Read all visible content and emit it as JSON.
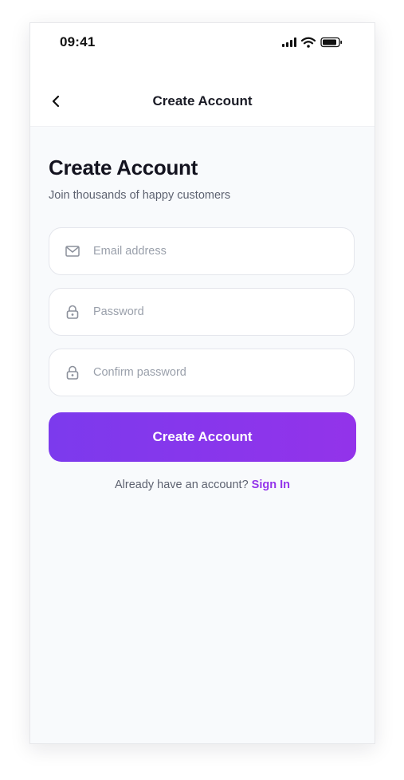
{
  "status_bar": {
    "time": "09:41",
    "icons": [
      "signal-icon",
      "wifi-icon",
      "battery-icon"
    ]
  },
  "nav": {
    "back_icon": "chevron-left-icon",
    "title": "Create Account"
  },
  "form": {
    "heading": "Create Account",
    "subheading": "Join thousands of happy customers",
    "email": {
      "icon": "mail-icon",
      "value": "",
      "placeholder": "Email address"
    },
    "password": {
      "icon": "lock-icon",
      "value": "",
      "placeholder": "Password"
    },
    "confirm_password": {
      "icon": "lock-icon",
      "value": "",
      "placeholder": "Confirm password"
    },
    "submit_label": "Create Account",
    "signin_prompt": "Already have an account?",
    "signin_link": "Sign In"
  },
  "colors": {
    "accent_start": "#7c3aed",
    "accent_end": "#9333ea",
    "link": "#9333ea",
    "background": "#f8fafc"
  }
}
